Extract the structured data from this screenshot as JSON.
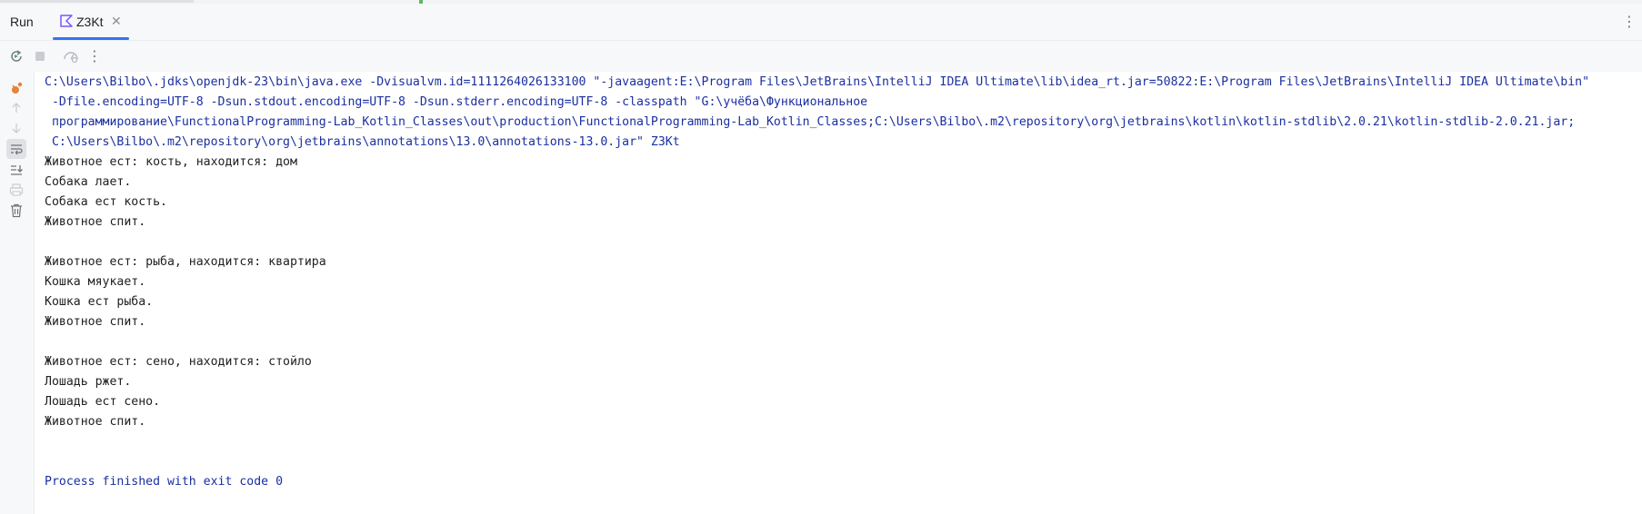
{
  "window": {
    "tool_window_title": "Run",
    "tab": {
      "label": "Z3Kt",
      "close_glyph": "✕"
    },
    "kebab_glyph": "⋮"
  },
  "toolbar": {
    "buttons": [
      {
        "name": "rerun-icon"
      },
      {
        "name": "stop-icon"
      },
      {
        "name": "profiler-icon"
      },
      {
        "name": "more-icon",
        "glyph": "⋮"
      }
    ]
  },
  "gutter": {
    "buttons": [
      {
        "name": "debug-icon",
        "active": false
      },
      {
        "name": "scroll-up-icon",
        "active": false
      },
      {
        "name": "scroll-down-icon",
        "active": false
      },
      {
        "name": "soft-wrap-icon",
        "active": true
      },
      {
        "name": "scroll-to-end-icon",
        "active": false
      },
      {
        "name": "print-icon",
        "active": false
      },
      {
        "name": "clear-all-icon",
        "active": false
      }
    ]
  },
  "colors": {
    "accent": "#3574f0",
    "command_text": "#1a2fa0",
    "output_text": "#1e1f22",
    "debug_orange": "#e8823a",
    "rerun_green": "#4caa5a"
  },
  "console": {
    "lines": [
      {
        "type": "cmd",
        "text": "C:\\Users\\Bilbo\\.jdks\\openjdk-23\\bin\\java.exe -Dvisualvm.id=1111264026133100 \"-javaagent:E:\\Program Files\\JetBrains\\IntelliJ IDEA Ultimate\\lib\\idea_rt.jar=50822:E:\\Program Files\\JetBrains\\IntelliJ IDEA Ultimate\\bin\""
      },
      {
        "type": "cmd",
        "text": " -Dfile.encoding=UTF-8 -Dsun.stdout.encoding=UTF-8 -Dsun.stderr.encoding=UTF-8 -classpath \"G:\\учёба\\Функциональное"
      },
      {
        "type": "cmd",
        "text": " программирование\\FunctionalProgramming-Lab_Kotlin_Classes\\out\\production\\FunctionalProgramming-Lab_Kotlin_Classes;C:\\Users\\Bilbo\\.m2\\repository\\org\\jetbrains\\kotlin\\kotlin-stdlib\\2.0.21\\kotlin-stdlib-2.0.21.jar;"
      },
      {
        "type": "cmd",
        "text": " C:\\Users\\Bilbo\\.m2\\repository\\org\\jetbrains\\annotations\\13.0\\annotations-13.0.jar\" Z3Kt"
      },
      {
        "type": "out",
        "text": "Животное ест: кость, находится: дом"
      },
      {
        "type": "out",
        "text": "Собака лает."
      },
      {
        "type": "out",
        "text": "Собака ест кость."
      },
      {
        "type": "out",
        "text": "Животное спит."
      },
      {
        "type": "out",
        "text": ""
      },
      {
        "type": "out",
        "text": "Животное ест: рыба, находится: квартира"
      },
      {
        "type": "out",
        "text": "Кошка мяукает."
      },
      {
        "type": "out",
        "text": "Кошка ест рыба."
      },
      {
        "type": "out",
        "text": "Животное спит."
      },
      {
        "type": "out",
        "text": ""
      },
      {
        "type": "out",
        "text": "Животное ест: сено, находится: стойло"
      },
      {
        "type": "out",
        "text": "Лошадь ржет."
      },
      {
        "type": "out",
        "text": "Лошадь ест сено."
      },
      {
        "type": "out",
        "text": "Животное спит."
      },
      {
        "type": "out",
        "text": ""
      },
      {
        "type": "out",
        "text": ""
      },
      {
        "type": "exit",
        "text": "Process finished with exit code 0"
      }
    ]
  }
}
